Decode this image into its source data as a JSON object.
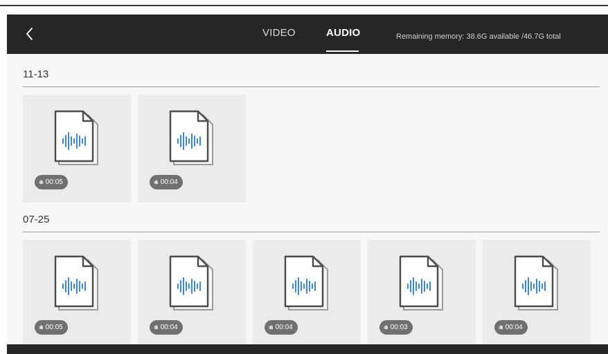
{
  "header": {
    "back_icon": "chevron-left-icon",
    "tabs": [
      {
        "label": "VIDEO",
        "active": false
      },
      {
        "label": "AUDIO",
        "active": true
      }
    ],
    "memory_text": "Remaining memory: 38.6G available /46.7G total"
  },
  "sections": [
    {
      "date": "11-13",
      "items": [
        {
          "duration": "00:05",
          "icon": "audio-file-icon"
        },
        {
          "duration": "00:04",
          "icon": "audio-file-icon"
        }
      ]
    },
    {
      "date": "07-25",
      "items": [
        {
          "duration": "00:05",
          "icon": "audio-file-icon"
        },
        {
          "duration": "00:04",
          "icon": "audio-file-icon"
        },
        {
          "duration": "00:04",
          "icon": "audio-file-icon"
        },
        {
          "duration": "00:03",
          "icon": "audio-file-icon"
        },
        {
          "duration": "00:04",
          "icon": "audio-file-icon"
        }
      ]
    }
  ],
  "colors": {
    "header_bg": "#262626",
    "waveform_blue": "#3a86d6",
    "tile_bg": "#ebebeb",
    "badge_bg": "#707070"
  }
}
